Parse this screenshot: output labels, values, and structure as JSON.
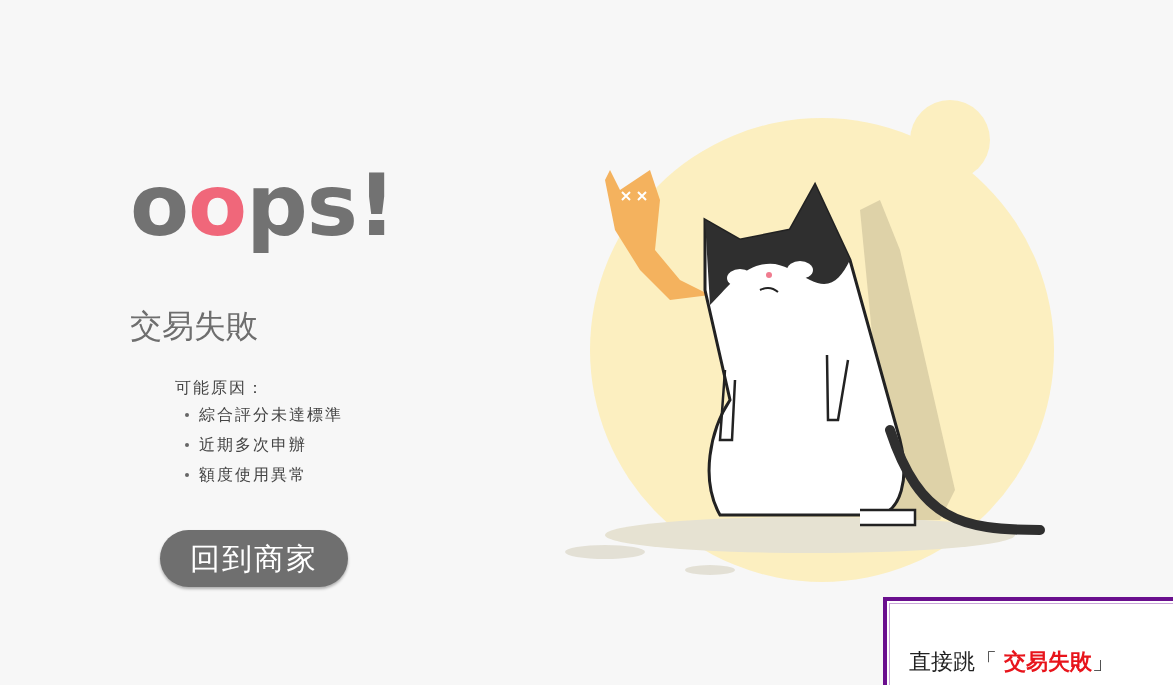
{
  "heading": {
    "parts": [
      {
        "text": "o",
        "accent": false
      },
      {
        "text": "o",
        "accent": true
      },
      {
        "text": "ps!",
        "accent": false
      }
    ]
  },
  "title": "交易失敗",
  "reasons": {
    "label": "可能原因：",
    "items": [
      "綜合評分未達標準",
      "近期多次申辦",
      "額度使用異常"
    ]
  },
  "back_button": "回到商家",
  "annotation": "直接跳「 **交易失敗**」"
}
